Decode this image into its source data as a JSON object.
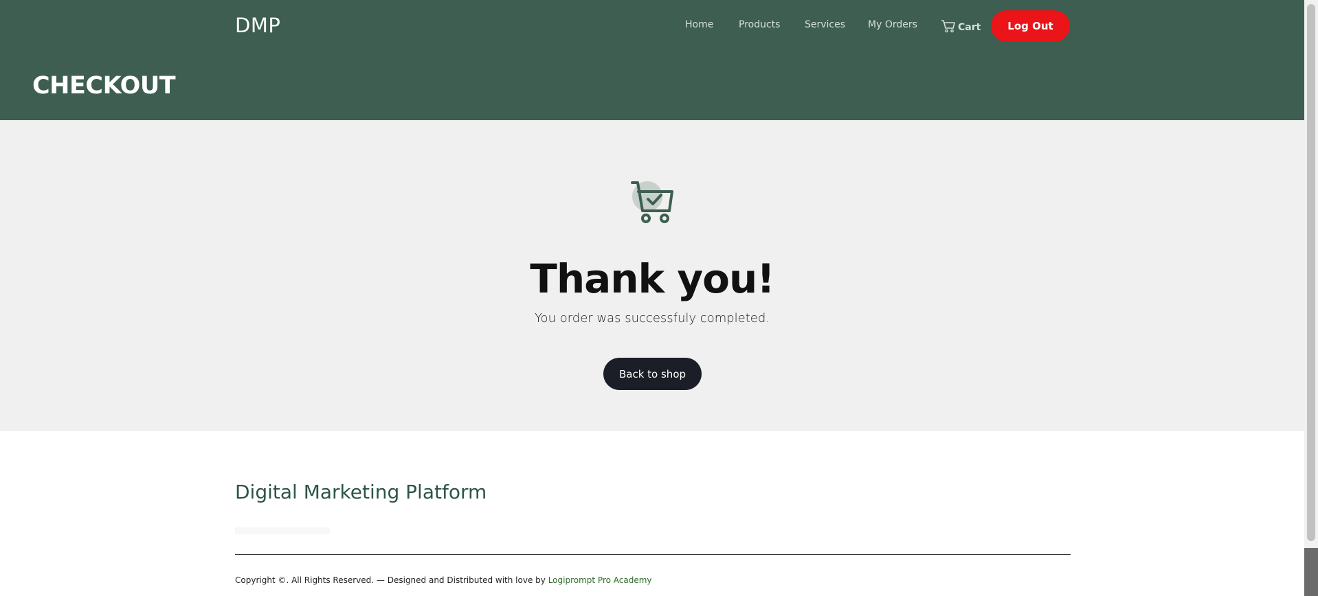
{
  "header": {
    "brand": "DMP",
    "nav": {
      "home": "Home",
      "products": "Products",
      "services": "Services",
      "my_orders": "My Orders",
      "cart": "Cart"
    },
    "logout_label": "Log Out",
    "page_title": "CHECKOUT"
  },
  "main": {
    "heading": "Thank you!",
    "message": "You order was successfuly completed.",
    "back_button": "Back to shop"
  },
  "footer": {
    "title": "Digital Marketing Platform",
    "copyright": "Copyright ©. All Rights Reserved. — Designed and Distributed with love by ",
    "link_text": "Logiprompt Pro Academy"
  },
  "colors": {
    "header_bg": "#3d5e51",
    "logout_bg": "#ea1419",
    "hero_bg": "#eff0ef",
    "button_dark": "#1b1e27",
    "footer_title": "#2d5546"
  },
  "icons": {
    "cart": "cart-icon",
    "success": "cart-check-icon"
  }
}
